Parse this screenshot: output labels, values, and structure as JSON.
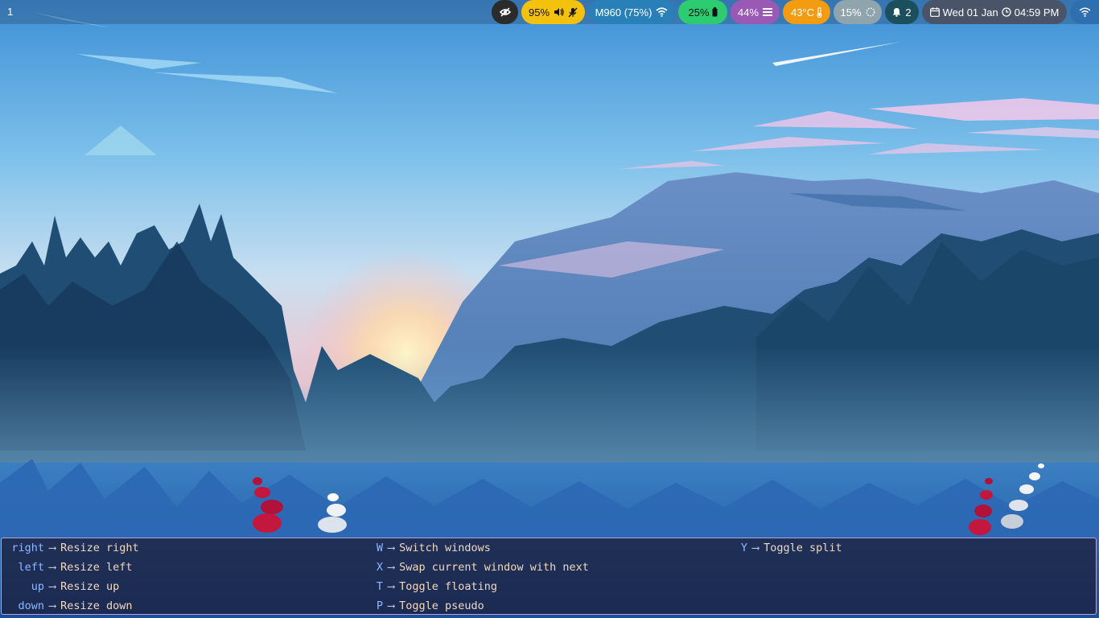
{
  "topbar": {
    "workspace": "1",
    "modules": {
      "volume": {
        "text": "95%",
        "icons": [
          "speaker-icon",
          "mic-muted-icon"
        ],
        "bg": "#f4c20d",
        "fg": "#111111"
      },
      "network": {
        "text": "M960 (75%)",
        "icon": "wifi-icon",
        "bg": "#2980b9"
      },
      "battery": {
        "text": "25%",
        "icon": "battery-icon",
        "bg": "#2ecc71",
        "fg": "#111111"
      },
      "memory": {
        "text": "44%",
        "icon": "memory-icon",
        "bg": "#9b59b6"
      },
      "temperature": {
        "text": "43°C",
        "icon": "thermometer-icon",
        "bg": "#f39c12"
      },
      "cpu": {
        "text": "15%",
        "icon": "cpu-icon",
        "bg": "#90a4ae"
      },
      "notifications": {
        "text": "2",
        "icon": "bell-icon",
        "bg": "#1b4f5e"
      },
      "clock": {
        "text": "Wed 01 Jan",
        "time": "04:59 PM",
        "icons": [
          "calendar-icon",
          "clock-icon"
        ],
        "bg": "#4a5468"
      },
      "idle_inhibitor": {
        "icon": "eye-off-icon",
        "bg": "#2b2b2b"
      },
      "wifi_tray": {
        "icon": "wifi-icon",
        "bg": "#2e6fb0"
      }
    }
  },
  "whichkey": {
    "columns": [
      [
        {
          "key": "right",
          "desc": "Resize right"
        },
        {
          "key": "left",
          "desc": "Resize left"
        },
        {
          "key": "up",
          "desc": "Resize up"
        },
        {
          "key": "down",
          "desc": "Resize down"
        }
      ],
      [
        {
          "key": "W",
          "desc": "Switch windows"
        },
        {
          "key": "X",
          "desc": "Swap current window with next"
        },
        {
          "key": "T",
          "desc": "Toggle floating"
        },
        {
          "key": "P",
          "desc": "Toggle pseudo"
        }
      ],
      [
        {
          "key": "Y",
          "desc": "Toggle split"
        }
      ]
    ],
    "arrow": "⟶",
    "colors": {
      "key": "#8fb8ff",
      "desc": "#f2d9bf",
      "border": "#b9a3d8"
    }
  }
}
